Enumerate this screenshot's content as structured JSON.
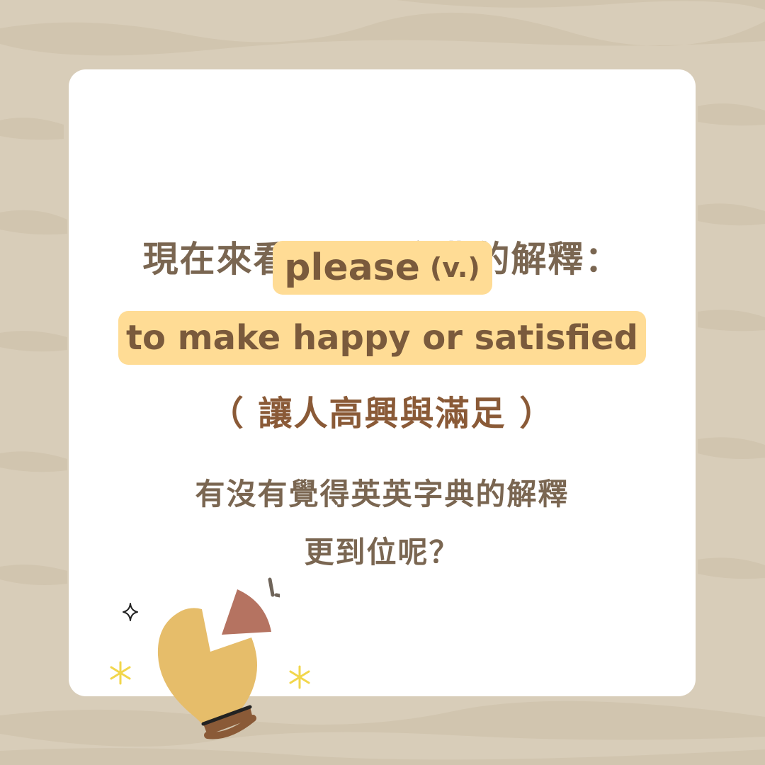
{
  "heading": "現在來看看英英字典的解釋：",
  "word": "please",
  "part_of_speech": "(v.)",
  "definition": "to make happy or satisfied",
  "translation": "（ 讓人高興與滿足 ）",
  "question_line1": "有沒有覺得英英字典的解釋",
  "question_line2": "更到位呢？",
  "colors": {
    "background": "#d8cdb9",
    "card": "#ffffff",
    "highlight": "#ffdc95",
    "heading_text": "#7a6651",
    "translation_text": "#8a5a37",
    "bulb": "#e6bd6a",
    "bulb_piece": "#b57361"
  },
  "icons": [
    "lightbulb-icon",
    "sparkle-icon",
    "asterisk-star-icon"
  ]
}
